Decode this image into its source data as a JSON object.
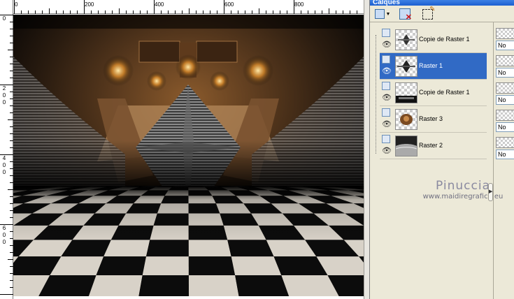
{
  "canvas": {
    "ruler_top_labels": [
      "0",
      "200",
      "400",
      "600",
      "800"
    ],
    "ruler_left_labels": [
      [
        "0"
      ],
      [
        "2",
        "0",
        "0"
      ],
      [
        "4",
        "0",
        "0"
      ],
      [
        "6",
        "0",
        "0"
      ]
    ]
  },
  "layers_panel": {
    "title": "Calques",
    "toolbar": [
      {
        "icon": "new-layer-dropdown-icon"
      },
      {
        "icon": "delete-layer-icon"
      },
      {
        "icon": "edit-selection-icon"
      }
    ],
    "layers": [
      {
        "name": "Copie de Raster 1",
        "selected": false,
        "thumb": "star-shape",
        "visible": true
      },
      {
        "name": "Raster 1",
        "selected": true,
        "thumb": "star-shape",
        "visible": true
      },
      {
        "name": "Copie de Raster 1",
        "selected": false,
        "thumb": "dark-bottom",
        "visible": true
      },
      {
        "name": "Raster 3",
        "selected": false,
        "thumb": "face",
        "visible": true
      },
      {
        "name": "Raster 2",
        "selected": false,
        "thumb": "grey-floor",
        "visible": true
      }
    ],
    "blend_fields": [
      "No",
      "No",
      "No",
      "No",
      "No"
    ],
    "watermark": {
      "name": "Pinuccia",
      "url": "www.maidiregrafica.eu"
    }
  }
}
